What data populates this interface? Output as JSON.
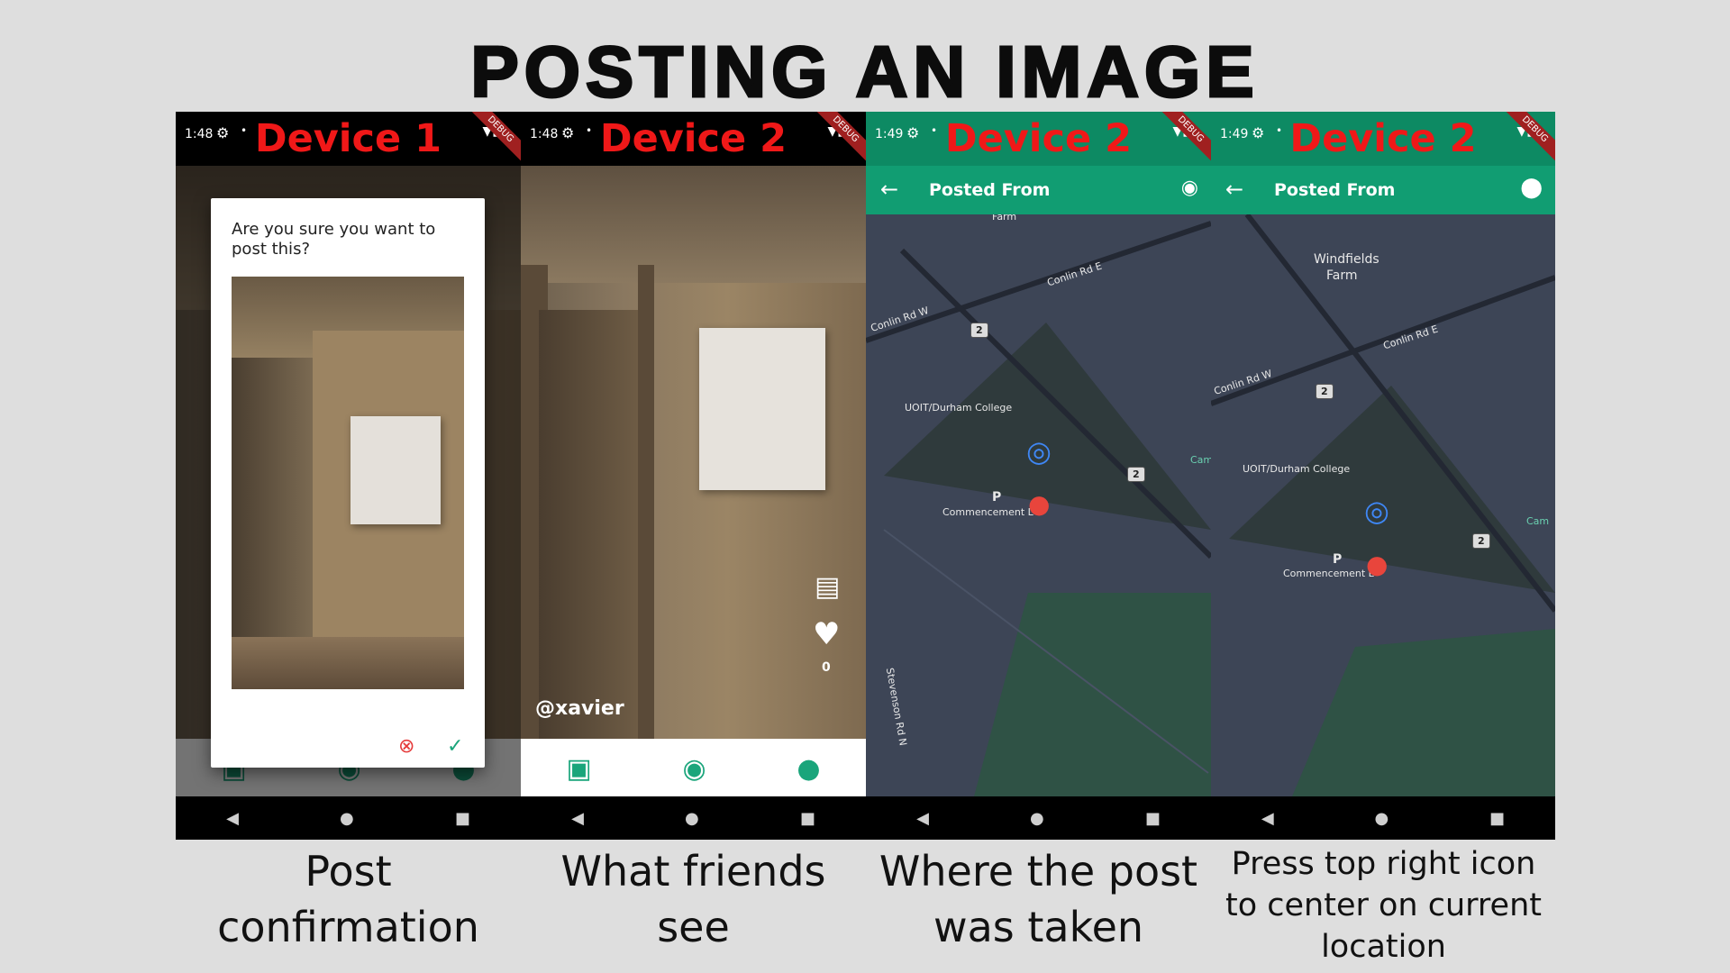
{
  "title": "POSTING AN IMAGE",
  "panels": [
    {
      "time": "1:48",
      "device": "Device 1",
      "debug": "DEBUG",
      "caption": "Post confirmation"
    },
    {
      "time": "1:48",
      "device": "Device 2",
      "debug": "DEBUG",
      "caption": "What friends see"
    },
    {
      "time": "1:49",
      "device": "Device 2",
      "debug": "DEBUG",
      "caption": "Where the post was taken"
    },
    {
      "time": "1:49",
      "device": "Device 2",
      "debug": "DEBUG",
      "caption": "Press top right icon to center on current location"
    }
  ],
  "dialog": {
    "question": "Are you sure you want to post this?",
    "cancel_icon": "cancel-circle-icon",
    "confirm_icon": "check-icon"
  },
  "feed": {
    "username": "@xavier",
    "like_count": "0",
    "icons": [
      "map-icon",
      "heart-icon"
    ]
  },
  "bottom_nav": {
    "icons": [
      "gallery-icon",
      "camera-shutter-icon",
      "profile-icon"
    ],
    "accent": "#1aa57b"
  },
  "map_screen": {
    "title": "Posted From",
    "action_icons": [
      "compass-icon",
      "location-pin-icon"
    ],
    "accent": "#119d72",
    "map_bg": "#3d4556"
  },
  "map_labels": {
    "farm": "Farm",
    "windfields": "Windfields",
    "windfields_farm": "Farm",
    "conlin_e": "Conlin Rd E",
    "conlin_w": "Conlin Rd W",
    "college": "UOIT/Durham College",
    "commencement": "Commencement L",
    "parking": "P",
    "route": "2",
    "stevenson": "Stevenson Rd N",
    "cam": "Cam"
  },
  "system_nav": {
    "icons": [
      "back-triangle-icon",
      "home-circle-icon",
      "recents-square-icon"
    ]
  }
}
